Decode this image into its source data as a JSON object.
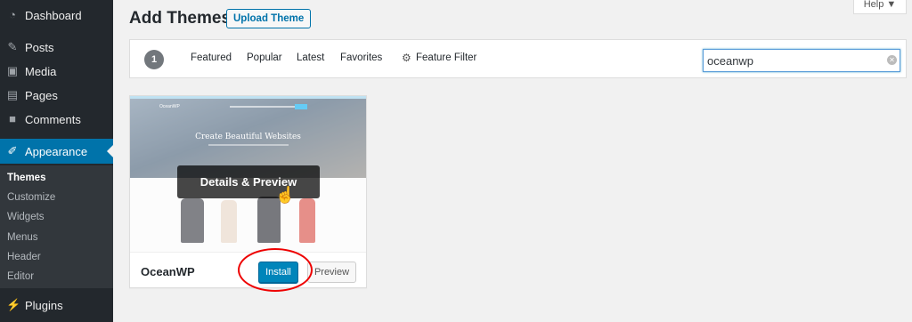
{
  "sidebar": {
    "items": [
      {
        "label": "Dashboard",
        "icon": "dashboard-icon"
      },
      {
        "label": "Posts",
        "icon": "pin-icon"
      },
      {
        "label": "Media",
        "icon": "media-icon"
      },
      {
        "label": "Pages",
        "icon": "pages-icon"
      },
      {
        "label": "Comments",
        "icon": "comment-icon"
      },
      {
        "label": "Appearance",
        "icon": "brush-icon",
        "active": true
      },
      {
        "label": "Plugins",
        "icon": "plug-icon"
      }
    ],
    "submenu": [
      {
        "label": "Themes",
        "current": true
      },
      {
        "label": "Customize"
      },
      {
        "label": "Widgets"
      },
      {
        "label": "Menus"
      },
      {
        "label": "Header"
      },
      {
        "label": "Editor"
      }
    ]
  },
  "header": {
    "title": "Add Themes",
    "upload_label": "Upload Theme",
    "help_label": "Help ▼"
  },
  "filters": {
    "count": "1",
    "links": [
      "Featured",
      "Popular",
      "Latest",
      "Favorites"
    ],
    "feature_filter_label": "Feature Filter",
    "search_value": "oceanwp"
  },
  "theme_card": {
    "name": "OceanWP",
    "details_label": "Details & Preview",
    "install_label": "Install",
    "preview_label": "Preview",
    "screenshot": {
      "logo": "OceanWP",
      "hero_text": "Create Beautiful Websites"
    }
  },
  "colors": {
    "sidebar_bg": "#23282d",
    "active_menu": "#0073aa",
    "install_button": "#0085ba",
    "annotation_circle": "#ee0000"
  }
}
